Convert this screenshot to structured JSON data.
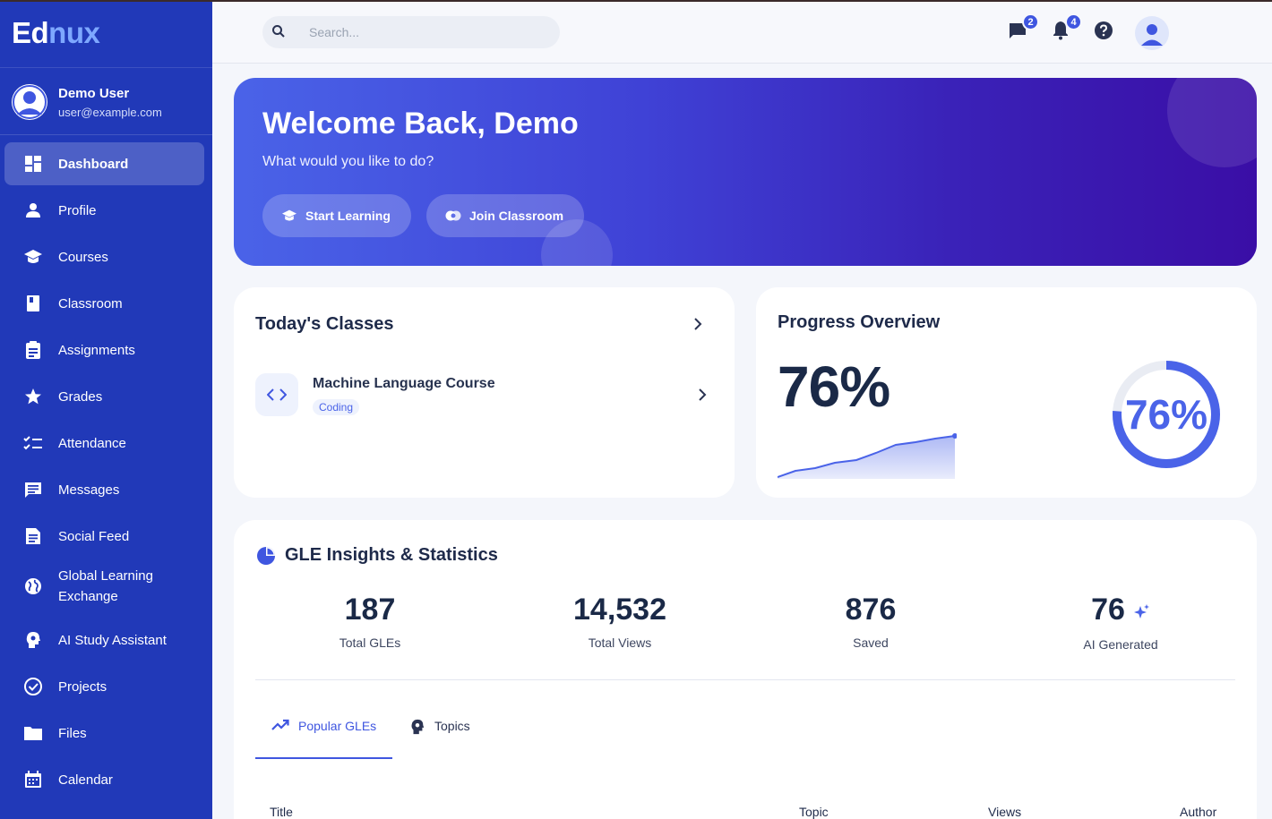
{
  "app": {
    "logo_part1": "Ed",
    "logo_part2": "nux"
  },
  "user": {
    "name": "Demo User",
    "email": "user@example.com"
  },
  "sidebar": {
    "items": [
      {
        "label": "Dashboard",
        "icon": "dashboard-icon",
        "active": true
      },
      {
        "label": "Profile",
        "icon": "person-icon"
      },
      {
        "label": "Courses",
        "icon": "graduation-cap-icon"
      },
      {
        "label": "Classroom",
        "icon": "book-icon"
      },
      {
        "label": "Assignments",
        "icon": "clipboard-icon"
      },
      {
        "label": "Grades",
        "icon": "star-icon"
      },
      {
        "label": "Attendance",
        "icon": "checklist-icon"
      },
      {
        "label": "Messages",
        "icon": "chat-icon"
      },
      {
        "label": "Social Feed",
        "icon": "feed-icon"
      },
      {
        "label": "Global Learning Exchange",
        "icon": "globe-icon"
      },
      {
        "label": "AI Study Assistant",
        "icon": "brain-icon"
      },
      {
        "label": "Projects",
        "icon": "check-circle-icon"
      },
      {
        "label": "Files",
        "icon": "folder-icon"
      },
      {
        "label": "Calendar",
        "icon": "calendar-icon"
      }
    ]
  },
  "topbar": {
    "search_placeholder": "Search...",
    "messages_badge": "2",
    "notifications_badge": "4"
  },
  "hero": {
    "title": "Welcome Back, Demo",
    "subtitle": "What would you like to do?",
    "start_label": "Start Learning",
    "join_label": "Join Classroom"
  },
  "classes": {
    "title": "Today's Classes",
    "items": [
      {
        "name": "Machine Language Course",
        "tag": "Coding"
      }
    ]
  },
  "progress": {
    "title": "Progress Overview",
    "value_label": "76%",
    "ring_label": "76%",
    "percent": 76
  },
  "insights": {
    "title": "GLE Insights & Statistics",
    "stats": [
      {
        "value": "187",
        "label": "Total GLEs"
      },
      {
        "value": "14,532",
        "label": "Total Views"
      },
      {
        "value": "876",
        "label": "Saved"
      },
      {
        "value": "76",
        "label": "AI Generated"
      }
    ],
    "tabs": [
      {
        "label": "Popular GLEs",
        "active": true
      },
      {
        "label": "Topics"
      }
    ],
    "columns": [
      "Title",
      "Topic",
      "Views",
      "Author"
    ]
  },
  "colors": {
    "sidebar": "#2139b8",
    "accent": "#3f56e0",
    "hero_end": "#3a0ea6"
  }
}
